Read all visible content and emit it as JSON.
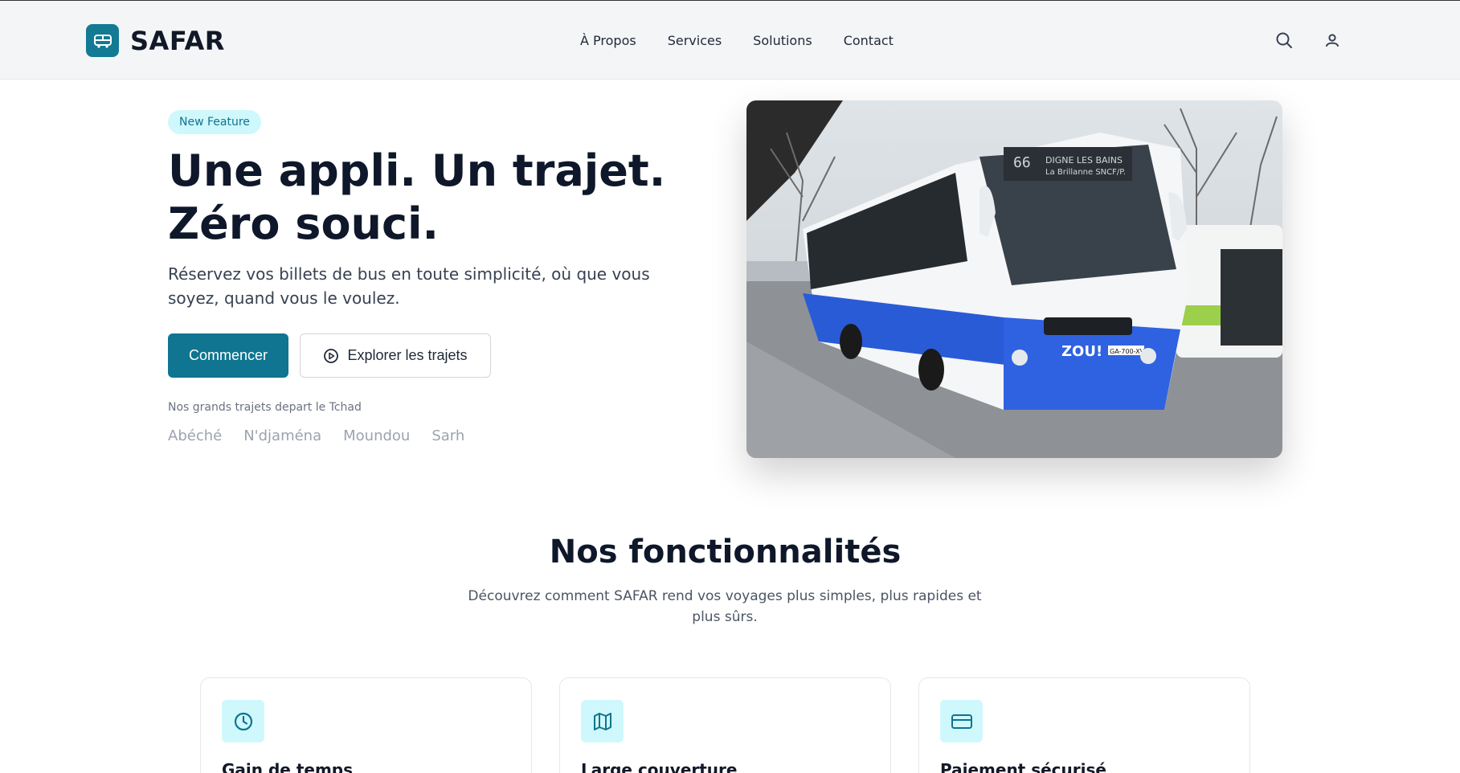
{
  "brand": {
    "name": "SAFAR",
    "accent": "#137a93"
  },
  "nav": {
    "items": [
      {
        "label": "À Propos"
      },
      {
        "label": "Services"
      },
      {
        "label": "Solutions"
      },
      {
        "label": "Contact"
      }
    ]
  },
  "header_icons": [
    "search-icon",
    "user-icon"
  ],
  "hero": {
    "badge": "New Feature",
    "title": "Une appli. Un trajet. Zéro souci.",
    "subtitle": "Réservez vos billets de bus en toute simplicité, où que vous soyez, quand vous le voulez.",
    "primary_button": "Commencer",
    "secondary_button": "Explorer les trajets",
    "routes_label": "Nos grands trajets depart le Tchad",
    "routes": [
      "Abéché",
      "N'djaména",
      "Moundou",
      "Sarh"
    ],
    "image": {
      "destination_line1": "DIGNE LES BAINS",
      "destination_line2": "La Brillanne SNCF/P.",
      "route_number": "66",
      "brand_on_bus": "ZOU!",
      "plate": "GA-700-XV"
    }
  },
  "features": {
    "title": "Nos fonctionnalités",
    "subtitle": "Découvrez comment SAFAR rend vos voyages plus simples, plus rapides et plus sûrs.",
    "cards": [
      {
        "title": "Gain de temps",
        "icon": "clock-icon"
      },
      {
        "title": "Large couverture",
        "icon": "map-icon"
      },
      {
        "title": "Paiement sécurisé",
        "icon": "credit-card-icon"
      }
    ]
  }
}
